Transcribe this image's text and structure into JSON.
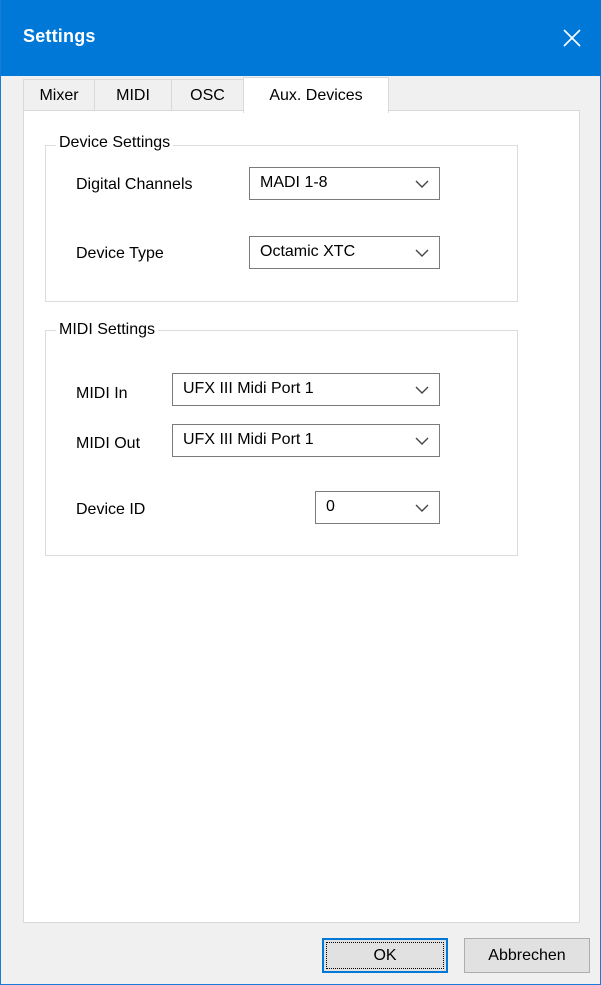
{
  "window": {
    "title": "Settings"
  },
  "tabs": [
    {
      "label": "Mixer"
    },
    {
      "label": "MIDI"
    },
    {
      "label": "OSC"
    },
    {
      "label": "Aux. Devices",
      "active": true
    }
  ],
  "device_settings": {
    "legend": "Device Settings",
    "digital_channels": {
      "label": "Digital Channels",
      "value": "MADI 1-8"
    },
    "device_type": {
      "label": "Device Type",
      "value": "Octamic XTC"
    }
  },
  "midi_settings": {
    "legend": "MIDI Settings",
    "midi_in": {
      "label": "MIDI In",
      "value": "UFX III Midi Port 1"
    },
    "midi_out": {
      "label": "MIDI Out",
      "value": "UFX III Midi Port 1"
    },
    "device_id": {
      "label": "Device ID",
      "value": "0"
    }
  },
  "buttons": {
    "ok": "OK",
    "cancel": "Abbrechen"
  },
  "colors": {
    "titlebar": "#0078d7",
    "accent": "#0078d7"
  },
  "icons": {
    "close": "close-icon",
    "dropdown": "chevron-down-icon"
  }
}
